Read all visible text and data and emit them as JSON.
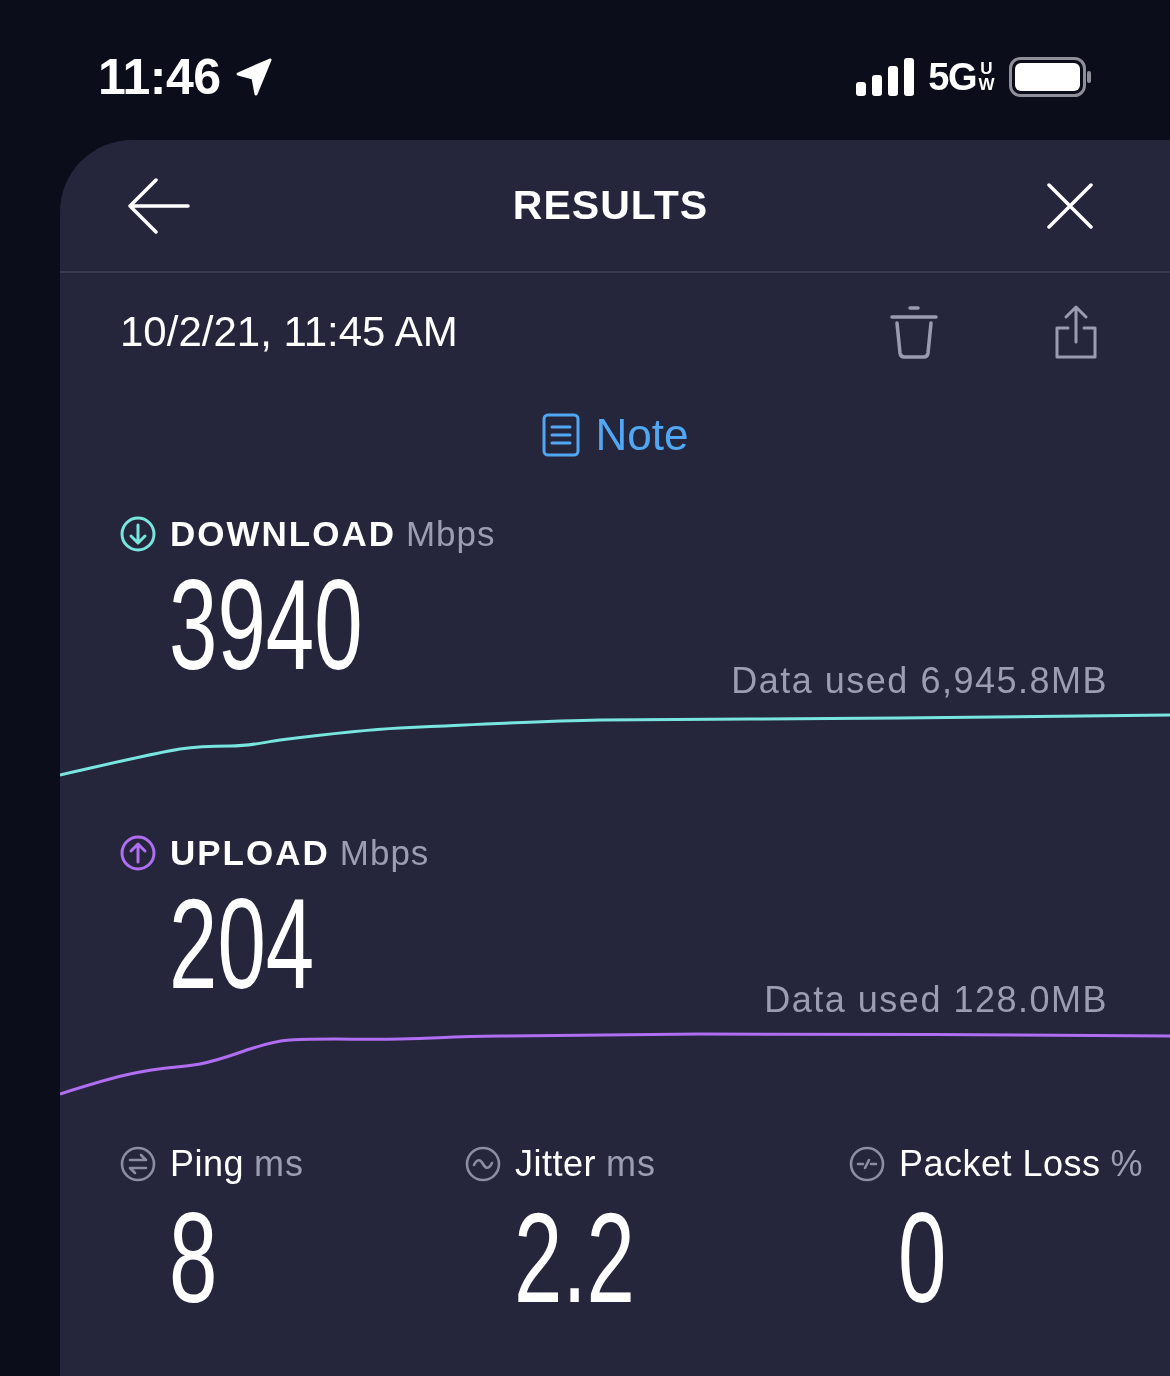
{
  "status_bar": {
    "time": "11:46",
    "network": "5G",
    "network_badge": "UW"
  },
  "header": {
    "title": "RESULTS"
  },
  "result": {
    "timestamp": "10/2/21, 11:45 AM",
    "note": "Note"
  },
  "speeds": [
    {
      "kind": "download",
      "label": "DOWNLOAD",
      "unit": "Mbps",
      "value": "3940",
      "data_used": "Data used 6,945.8MB",
      "color": "#78e6de"
    },
    {
      "kind": "upload",
      "label": "UPLOAD",
      "unit": "Mbps",
      "value": "204",
      "data_used": "Data used 128.0MB",
      "color": "#b06ef2"
    }
  ],
  "metrics": [
    {
      "kind": "ping",
      "label": "Ping",
      "unit": "ms",
      "value": "8"
    },
    {
      "kind": "jitter",
      "label": "Jitter",
      "unit": "ms",
      "value": "2.2"
    },
    {
      "kind": "packet_loss",
      "label": "Packet Loss",
      "unit": "%",
      "value": "0"
    }
  ]
}
